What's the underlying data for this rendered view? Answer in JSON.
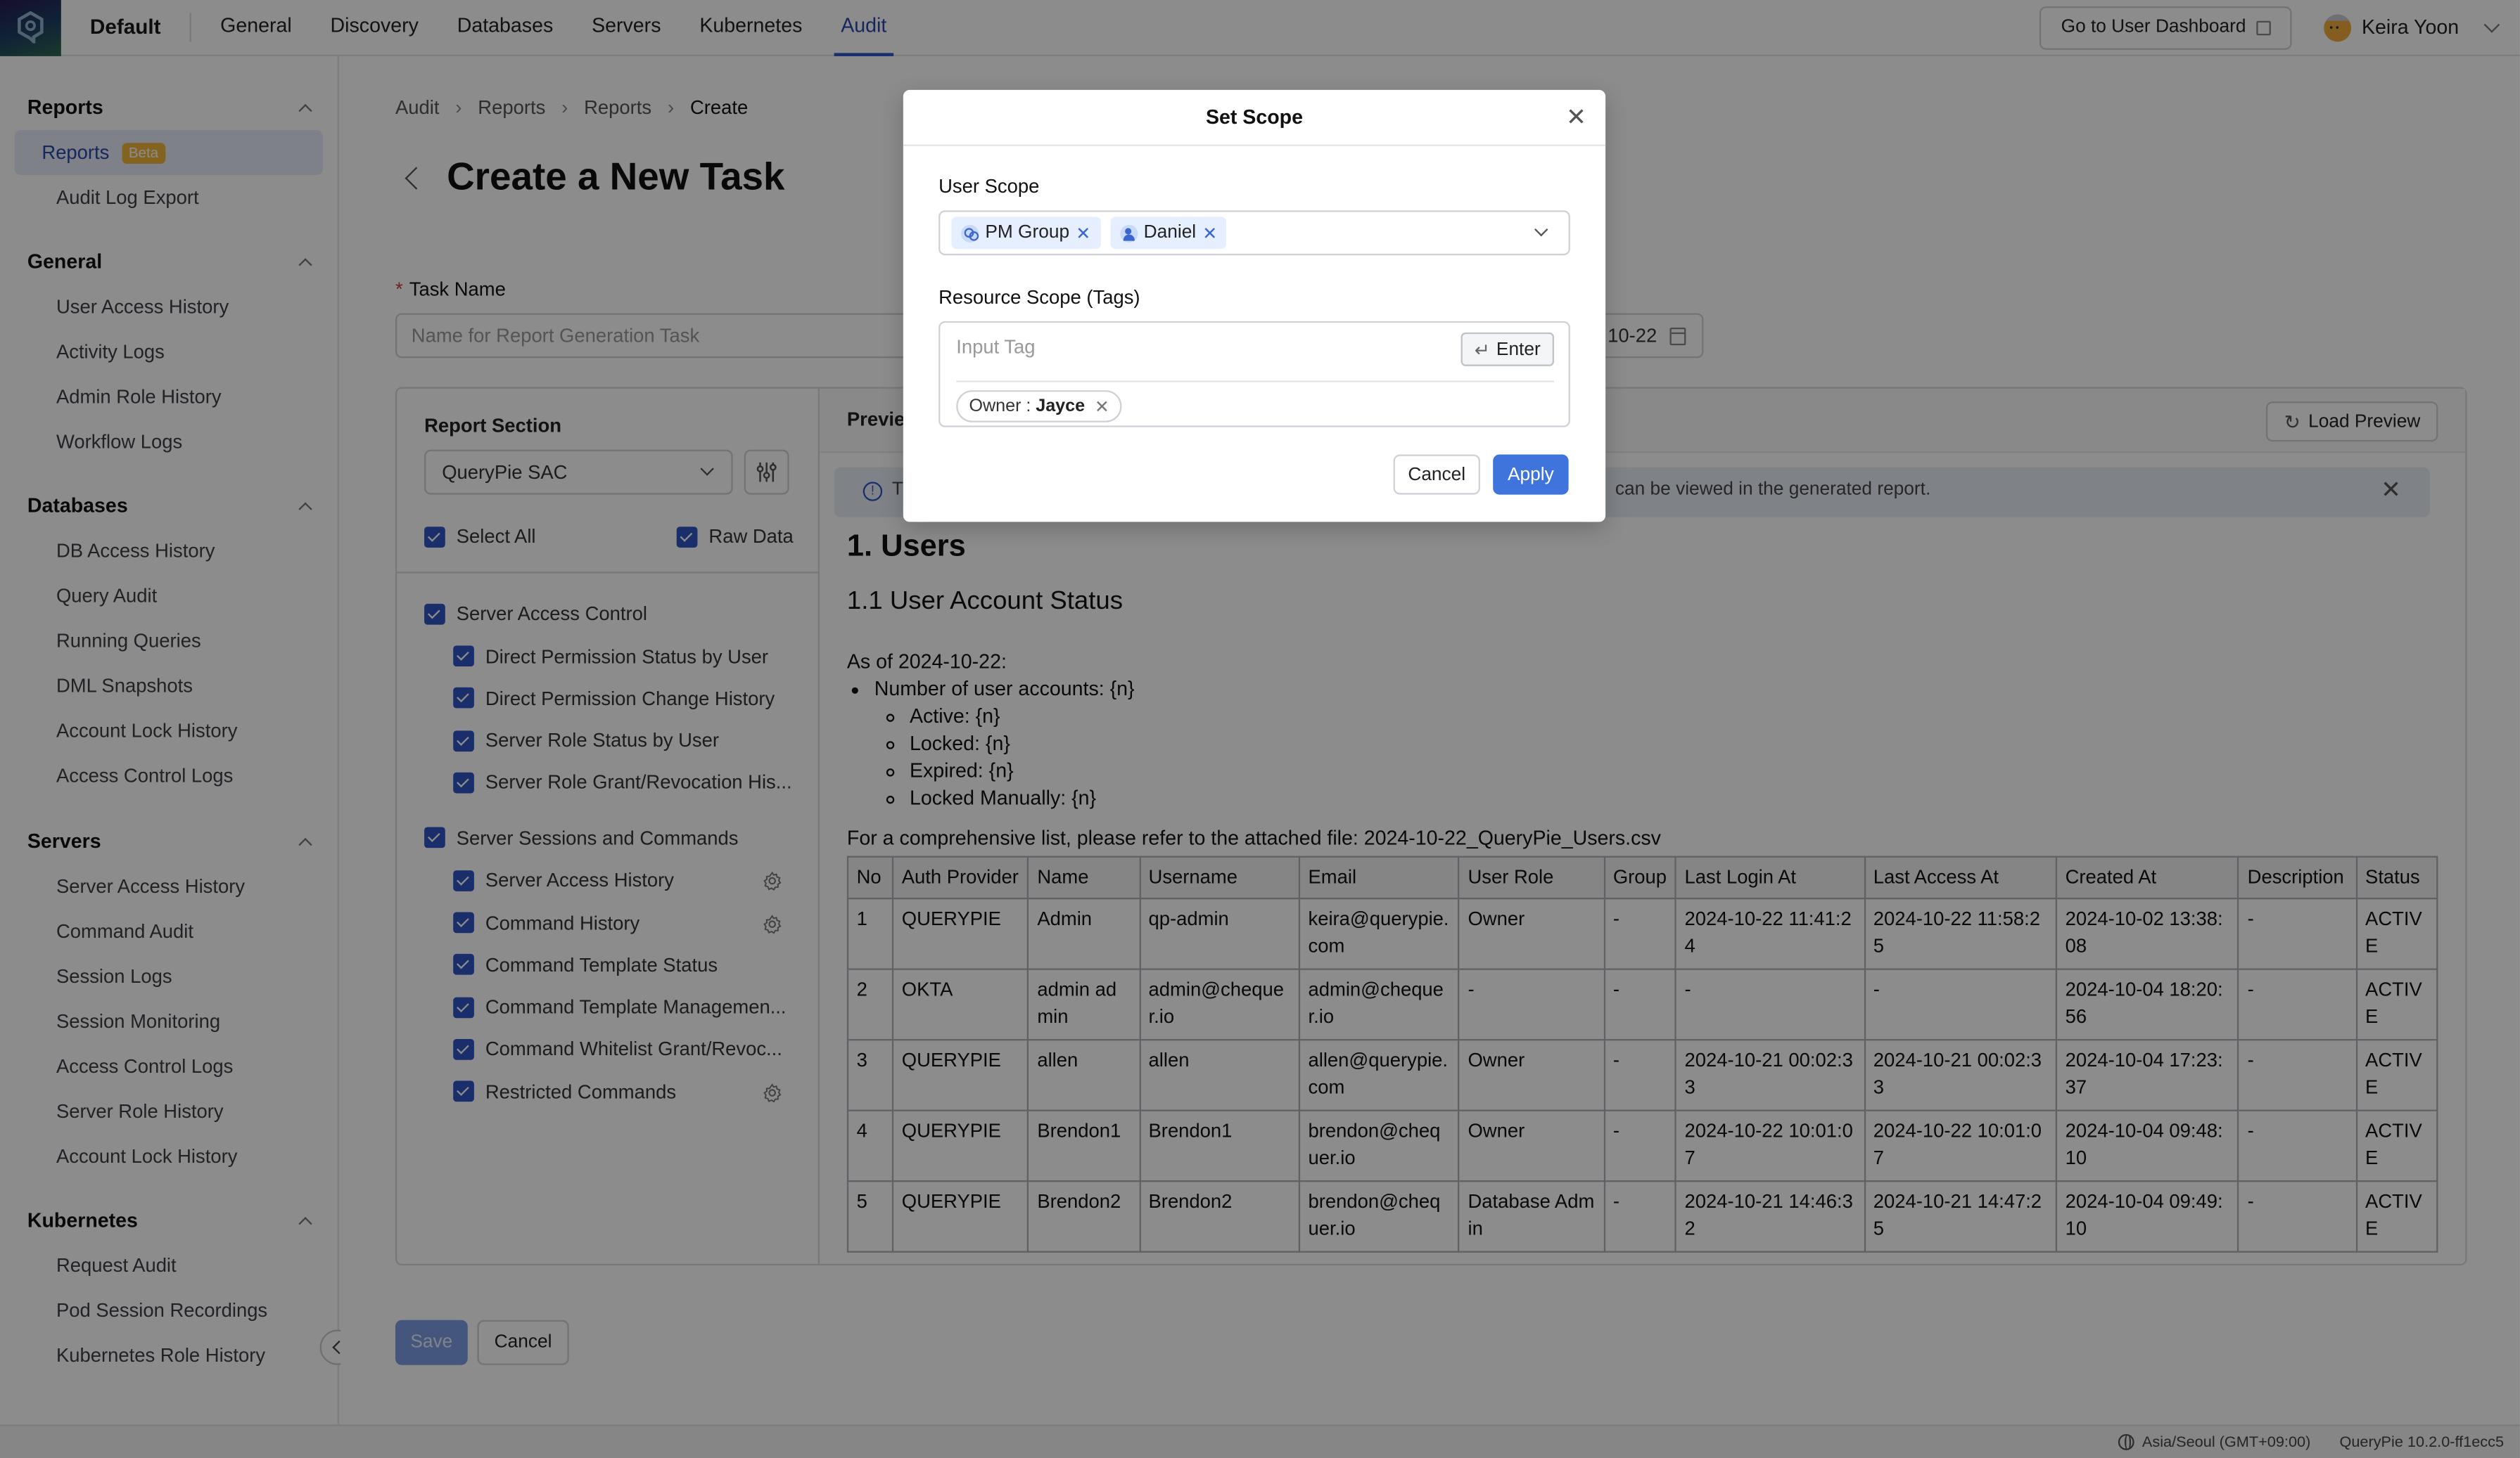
{
  "topbar": {
    "workspace": "Default",
    "nav": [
      {
        "label": "General",
        "active": false
      },
      {
        "label": "Discovery",
        "active": false
      },
      {
        "label": "Databases",
        "active": false
      },
      {
        "label": "Servers",
        "active": false
      },
      {
        "label": "Kubernetes",
        "active": false
      },
      {
        "label": "Audit",
        "active": true
      }
    ],
    "dashboard_button": "Go to User Dashboard",
    "user_name": "Keira Yoon"
  },
  "sidebar": {
    "groups": [
      {
        "title": "Reports",
        "items": [
          {
            "label": "Reports",
            "badge": "Beta",
            "active": true
          },
          {
            "label": "Audit Log Export"
          }
        ]
      },
      {
        "title": "General",
        "items": [
          {
            "label": "User Access History"
          },
          {
            "label": "Activity Logs"
          },
          {
            "label": "Admin Role History"
          },
          {
            "label": "Workflow Logs"
          }
        ]
      },
      {
        "title": "Databases",
        "items": [
          {
            "label": "DB Access History"
          },
          {
            "label": "Query Audit"
          },
          {
            "label": "Running Queries"
          },
          {
            "label": "DML Snapshots"
          },
          {
            "label": "Account Lock History"
          },
          {
            "label": "Access Control Logs"
          }
        ]
      },
      {
        "title": "Servers",
        "items": [
          {
            "label": "Server Access History"
          },
          {
            "label": "Command Audit"
          },
          {
            "label": "Session Logs"
          },
          {
            "label": "Session Monitoring"
          },
          {
            "label": "Access Control Logs"
          },
          {
            "label": "Server Role History"
          },
          {
            "label": "Account Lock History"
          }
        ]
      },
      {
        "title": "Kubernetes",
        "items": [
          {
            "label": "Request Audit"
          },
          {
            "label": "Pod Session Recordings"
          },
          {
            "label": "Kubernetes Role History"
          }
        ]
      }
    ]
  },
  "breadcrumb": [
    "Audit",
    "Reports",
    "Reports",
    "Create"
  ],
  "page_title": "Create a New Task",
  "form": {
    "task_name_label": "Task Name",
    "task_name_placeholder": "Name for Report Generation Task",
    "task_name_value": "",
    "date_value_visible": "10-22"
  },
  "report_section": {
    "label": "Report Section",
    "selected": "QueryPie SAC",
    "select_all": {
      "label": "Select All",
      "checked": true
    },
    "raw_data": {
      "label": "Raw Data",
      "checked": true
    },
    "groups": [
      {
        "label": "Server Access Control",
        "checked": true,
        "items": [
          {
            "label": "Direct Permission Status by User",
            "checked": true,
            "gear": false
          },
          {
            "label": "Direct Permission Change History",
            "checked": true,
            "gear": false
          },
          {
            "label": "Server Role Status by User",
            "checked": true,
            "gear": false
          },
          {
            "label": "Server Role Grant/Revocation His...",
            "checked": true,
            "gear": false
          }
        ]
      },
      {
        "label": "Server Sessions and Commands",
        "checked": true,
        "items": [
          {
            "label": "Server Access History",
            "checked": true,
            "gear": true
          },
          {
            "label": "Command History",
            "checked": true,
            "gear": true
          },
          {
            "label": "Command Template Status",
            "checked": true,
            "gear": false
          },
          {
            "label": "Command Template Managemen...",
            "checked": true,
            "gear": false
          },
          {
            "label": "Command Whitelist Grant/Revoc...",
            "checked": true,
            "gear": false
          },
          {
            "label": "Restricted Commands",
            "checked": true,
            "gear": true
          }
        ]
      }
    ]
  },
  "preview": {
    "title": "Preview",
    "load_button": "Load Preview",
    "banner_visible_start": "T",
    "banner_visible_end": "can be viewed in the generated report.",
    "doc": {
      "h1": "1. Users",
      "h2": "1.1 User Account Status",
      "as_of": "As of 2024-10-22:",
      "bullet": "Number of user accounts: {n}",
      "sub_bullets": [
        "Active: {n}",
        "Locked: {n}",
        "Expired: {n}",
        "Locked Manually: {n}"
      ],
      "reference": "For a comprehensive list, please refer to the attached file: 2024-10-22_QueryPie_Users.csv"
    },
    "table": {
      "columns": [
        "No",
        "Auth Provider",
        "Name",
        "Username",
        "Email",
        "User Role",
        "Group",
        "Last Login At",
        "Last Access At",
        "Created At",
        "Description",
        "Status"
      ],
      "rows": [
        [
          "1",
          "QUERYPIE",
          "Admin",
          "qp-admin",
          "keira@querypie.com",
          "Owner",
          "-",
          "2024-10-22 11:41:24",
          "2024-10-22 11:58:25",
          "2024-10-02 13:38:08",
          "-",
          "ACTIVE"
        ],
        [
          "2",
          "OKTA",
          "admin admin",
          "admin@chequer.io",
          "admin@chequer.io",
          "-",
          "-",
          "-",
          "-",
          "2024-10-04 18:20:56",
          "-",
          "ACTIVE"
        ],
        [
          "3",
          "QUERYPIE",
          "allen",
          "allen",
          "allen@querypie.com",
          "Owner",
          "-",
          "2024-10-21 00:02:33",
          "2024-10-21 00:02:33",
          "2024-10-04 17:23:37",
          "-",
          "ACTIVE"
        ],
        [
          "4",
          "QUERYPIE",
          "Brendon1",
          "Brendon1",
          "brendon@chequer.io",
          "Owner",
          "-",
          "2024-10-22 10:01:07",
          "2024-10-22 10:01:07",
          "2024-10-04 09:48:10",
          "-",
          "ACTIVE"
        ],
        [
          "5",
          "QUERYPIE",
          "Brendon2",
          "Brendon2",
          "brendon@chequer.io",
          "Database Admin",
          "-",
          "2024-10-21 14:46:32",
          "2024-10-21 14:47:25",
          "2024-10-04 09:49:10",
          "-",
          "ACTIVE"
        ]
      ]
    }
  },
  "actions": {
    "save": "Save",
    "cancel": "Cancel"
  },
  "footer": {
    "timezone": "Asia/Seoul (GMT+09:00)",
    "version": "QueryPie 10.2.0-ff1ecc5"
  },
  "modal": {
    "title": "Set Scope",
    "user_scope_label": "User Scope",
    "user_scope_chips": [
      {
        "label": "PM Group",
        "type": "group"
      },
      {
        "label": "Daniel",
        "type": "user"
      }
    ],
    "resource_scope_label": "Resource Scope (Tags)",
    "tag_input_placeholder": "Input Tag",
    "enter_button": "Enter",
    "tags": [
      {
        "key": "Owner",
        "value": "Jayce"
      }
    ],
    "cancel": "Cancel",
    "apply": "Apply"
  },
  "colors": {
    "accent": "#2f56c7",
    "apply": "#3f74dc",
    "beta": "#f0b43c",
    "checkbox": "#2e55c4"
  }
}
